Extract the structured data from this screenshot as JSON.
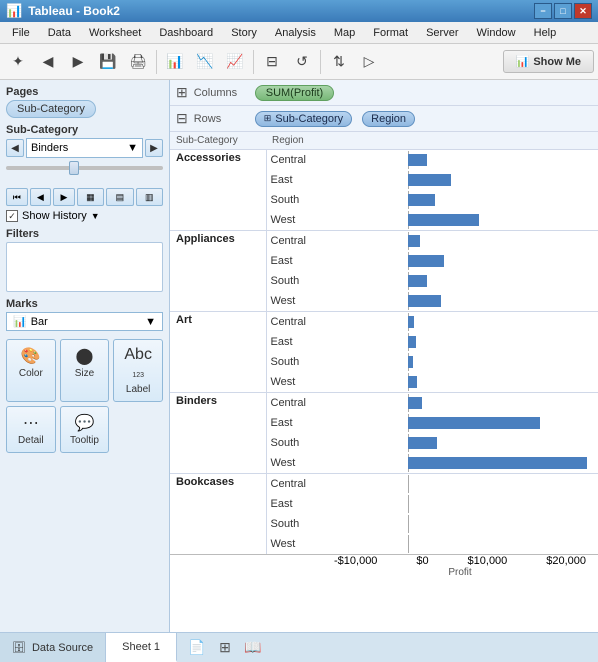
{
  "titleBar": {
    "title": "Tableau - Book2",
    "minimize": "−",
    "maximize": "□",
    "close": "✕"
  },
  "menuBar": {
    "items": [
      "File",
      "Data",
      "Worksheet",
      "Dashboard",
      "Story",
      "Analysis",
      "Map",
      "Format",
      "Server",
      "Window",
      "Help"
    ]
  },
  "toolbar": {
    "showMe": "Show Me",
    "showMeIcon": "📊"
  },
  "shelves": {
    "columnsLabel": "Columns",
    "columnsValue": "SUM(Profit)",
    "rowsLabel": "Rows",
    "rowsPill1": "Sub-Category",
    "rowsPill2": "Region"
  },
  "leftPanel": {
    "pagesTitle": "Pages",
    "pagesPill": "Sub-Category",
    "subCatTitle": "Sub-Category",
    "subCatValue": "Binders",
    "showHistoryLabel": "Show History",
    "filtersTitle": "Filters",
    "marksTitle": "Marks",
    "marksType": "Bar",
    "colorLabel": "Color",
    "sizeLabel": "Size",
    "labelLabel": "Label",
    "detailLabel": "Detail",
    "tooltipLabel": "Tooltip"
  },
  "chartHeaders": {
    "subCategory": "Sub-Category",
    "region": "Region"
  },
  "chartData": [
    {
      "group": "Accessories",
      "rows": [
        {
          "region": "Central",
          "value": 2000,
          "type": "positive"
        },
        {
          "region": "East",
          "value": 4500,
          "type": "positive"
        },
        {
          "region": "South",
          "value": 2800,
          "type": "positive"
        },
        {
          "region": "West",
          "value": 7500,
          "type": "positive"
        }
      ]
    },
    {
      "group": "Appliances",
      "rows": [
        {
          "region": "Central",
          "value": 1200,
          "type": "positive"
        },
        {
          "region": "East",
          "value": 3800,
          "type": "positive"
        },
        {
          "region": "South",
          "value": 2000,
          "type": "positive"
        },
        {
          "region": "West",
          "value": 3500,
          "type": "positive"
        }
      ]
    },
    {
      "group": "Art",
      "rows": [
        {
          "region": "Central",
          "value": 600,
          "type": "positive"
        },
        {
          "region": "East",
          "value": 800,
          "type": "positive"
        },
        {
          "region": "South",
          "value": 500,
          "type": "positive"
        },
        {
          "region": "West",
          "value": 900,
          "type": "positive"
        }
      ]
    },
    {
      "group": "Binders",
      "rows": [
        {
          "region": "Central",
          "value": 1500,
          "type": "positive"
        },
        {
          "region": "East",
          "value": 14000,
          "type": "positive"
        },
        {
          "region": "South",
          "value": 3000,
          "type": "positive"
        },
        {
          "region": "West",
          "value": 19000,
          "type": "positive"
        }
      ]
    },
    {
      "group": "Bookcases",
      "rows": [
        {
          "region": "Central",
          "value": 0,
          "type": "zero"
        },
        {
          "region": "East",
          "value": 0,
          "type": "zero"
        },
        {
          "region": "South",
          "value": 0,
          "type": "zero"
        },
        {
          "region": "West",
          "value": 0,
          "type": "zero"
        }
      ]
    }
  ],
  "xAxis": {
    "labels": [
      "-$10,000",
      "$0",
      "$10,000",
      "$20,000"
    ],
    "title": "Profit"
  },
  "tabBar": {
    "dataSourceLabel": "Data Source",
    "sheetLabel": "Sheet 1"
  },
  "colors": {
    "barColor": "#4a7fbf",
    "accentBlue": "#3a7ab8"
  }
}
